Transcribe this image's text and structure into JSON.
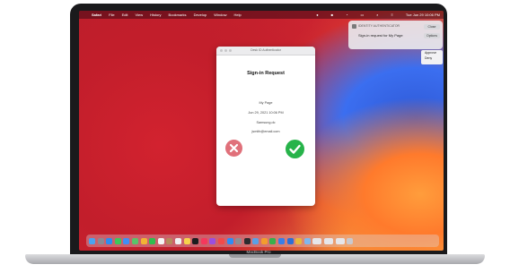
{
  "menubar": {
    "apple_icon": "apple-icon",
    "items": [
      "Safari",
      "File",
      "Edit",
      "View",
      "History",
      "Bookmarks",
      "Develop",
      "Window",
      "Help"
    ],
    "status_icons": [
      "mic-icon",
      "lock-icon",
      "wifi-icon",
      "battery-icon",
      "search-icon",
      "control-center-icon"
    ],
    "clock": "Tue Jun 29 10:06 PM"
  },
  "notification": {
    "app": "IDENTITY AUTHENTICATOR",
    "message": "Sign-in request for My Page",
    "button_label": "Close",
    "options_label": "Options",
    "menu": [
      "Approve",
      "Deny"
    ]
  },
  "dialog": {
    "window_title": "Desk ID Authenticator",
    "title": "Sign-in Request",
    "service": "My Page",
    "datetime": "Jun 29, 2021 10:06 PM",
    "user": "Samsung.dc",
    "email": "jsmith@email.com",
    "deny_icon": "x-icon",
    "approve_icon": "checkmark-icon"
  },
  "laptop_label": "MacBook Pro",
  "dock": {
    "apps": [
      "finder-icon",
      "launchpad-icon",
      "safari-icon",
      "messages-icon",
      "mail-icon",
      "maps-icon",
      "photos-icon",
      "facetime-icon",
      "calendar-icon",
      "contacts-icon",
      "reminders-icon",
      "notes-icon",
      "tv-icon",
      "music-icon",
      "podcasts-icon",
      "news-icon",
      "appstore-icon",
      "settings-icon",
      "terminal-icon",
      "preview-icon",
      "pages-icon",
      "numbers-icon",
      "keynote-icon",
      "xcode-icon",
      "chrome-icon",
      "folder-icon",
      "window-icon",
      "window-icon",
      "window-icon",
      "trash-icon"
    ]
  },
  "colors": {
    "approve": "#27b34a",
    "deny": "#e0707a",
    "wallpaper_red": "#cc2430",
    "wallpaper_blue": "#3b6ef0",
    "wallpaper_orange": "#f7b64c"
  }
}
